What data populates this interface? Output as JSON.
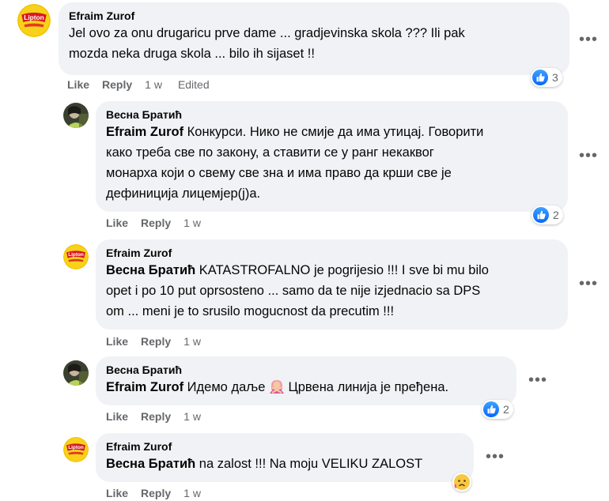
{
  "comments": [
    {
      "author": "Efraim Zurof",
      "line1": "Jel ovo za onu drugaricu prve dame ... gradjevinska skola ??? Ili pak",
      "line2": "mozda neka druga skola ... bilo ih sijaset !!",
      "like": "Like",
      "reply": "Reply",
      "time": "1 w",
      "edited": "Edited",
      "reactions": "3",
      "avatar_logo": "Lipton"
    },
    {
      "author": "Весна Братић",
      "mention": "Efraim Zurof",
      "line1": " Конкурси. Нико не смије да има утицај. Говорити",
      "line2": "како треба све по закону, а ставити се у ранг некаквог",
      "line3": "монарха који о свему све зна и има право да крши све је",
      "line4": "дефиниција лицемјер(ј)а.",
      "like": "Like",
      "reply": "Reply",
      "time": "1 w",
      "reactions": "2"
    },
    {
      "author": "Efraim Zurof",
      "mention": "Весна Братић",
      "line1": " KATASTROFALNO je pogrijesio !!! I sve bi mu bilo",
      "line2": "opet i po 10 put oprsosteno ... samo da te nije izjednacio sa DPS",
      "line3": "om ... meni je to srusilo mogucnost da precutim !!!",
      "like": "Like",
      "reply": "Reply",
      "time": "1 w",
      "avatar_logo": "Lipton"
    },
    {
      "author": "Весна Братић",
      "mention": "Efraim Zurof",
      "line1a": " Идемо даље ",
      "line1b": " Црвена линија је пређена.",
      "like": "Like",
      "reply": "Reply",
      "time": "1 w",
      "reactions": "2"
    },
    {
      "author": "Efraim Zurof",
      "mention": "Весна Братић",
      "line1": " na zalost !!! Na moju VELIKU ZALOST",
      "like": "Like",
      "reply": "Reply",
      "time": "1 w",
      "avatar_logo": "Lipton"
    }
  ],
  "more_glyph": "•••",
  "colors": {
    "bubble": "#f0f2f5",
    "secondary_text": "#65676b",
    "like_blue": "#0866ff"
  }
}
